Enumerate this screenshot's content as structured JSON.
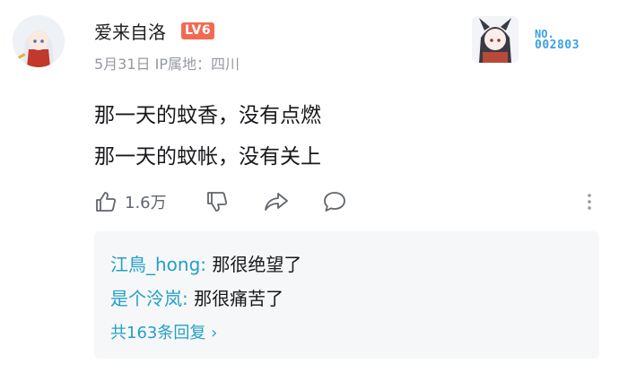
{
  "user": {
    "name": "爱来自洛",
    "level": "LV6",
    "date": "5月31日",
    "location_label": "IP属地：",
    "location": "四川"
  },
  "badge": {
    "prefix": "NO.",
    "number": "002803",
    "color": "#3aa0e6"
  },
  "comment": {
    "lines": [
      "那一天的蚊香，没有点燃",
      "那一天的蚊帐，没有关上"
    ]
  },
  "actions": {
    "like_icon": "thumb-up-icon",
    "like_count": "1.6万",
    "dislike_icon": "thumb-down-icon",
    "share_icon": "share-icon",
    "reply_icon": "comment-bubble-icon",
    "more_icon": "more-vertical-icon"
  },
  "replies": {
    "items": [
      {
        "author": "江鳥_hong",
        "separator": ":",
        "text": " 那很绝望了"
      },
      {
        "author": "是个泠岚",
        "separator": ":",
        "text": " 那很痛苦了"
      }
    ],
    "total_label": "共163条回复",
    "chevron": "›"
  },
  "colors": {
    "level_bg": "#f26a52",
    "link": "#23a0c8",
    "meta": "#9499a0"
  }
}
